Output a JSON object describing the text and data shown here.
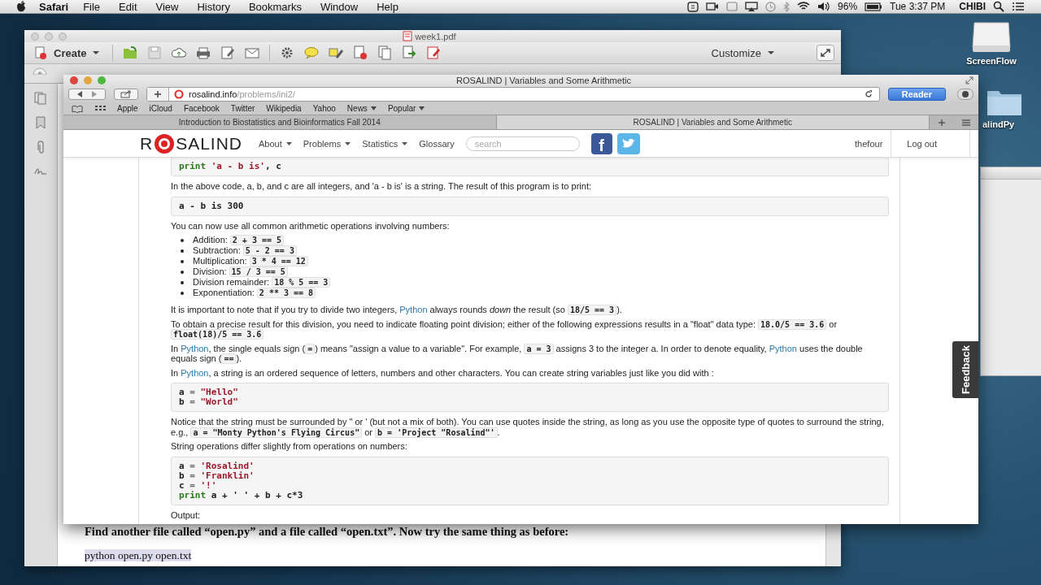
{
  "menubar": {
    "app": "Safari",
    "menus": [
      "File",
      "Edit",
      "View",
      "History",
      "Bookmarks",
      "Window",
      "Help"
    ],
    "battery": "96%",
    "clock": "Tue 3:37 PM",
    "user": "CHIBI"
  },
  "desktop_icons": [
    {
      "kind": "drive",
      "label": "ScreenFlow"
    },
    {
      "kind": "folder",
      "label": "alindPy"
    }
  ],
  "pdf_window": {
    "title": "week1.pdf",
    "create": "Create",
    "customize": "Customize",
    "body": [
      {
        "kind": "heading",
        "text": "Find another file called “open.py” and a file called “open.txt”. Now try the same thing as before:"
      },
      {
        "kind": "command",
        "text": "python open.py open.txt"
      }
    ]
  },
  "browser": {
    "title": "ROSALIND | Variables and Some Arithmetic",
    "url_host": "rosalind.info",
    "url_path": "/problems/ini2/",
    "reader": "Reader",
    "bookmarks": [
      {
        "label": "Apple",
        "dropdown": false
      },
      {
        "label": "iCloud",
        "dropdown": false
      },
      {
        "label": "Facebook",
        "dropdown": false
      },
      {
        "label": "Twitter",
        "dropdown": false
      },
      {
        "label": "Wikipedia",
        "dropdown": false
      },
      {
        "label": "Yahoo",
        "dropdown": false
      },
      {
        "label": "News",
        "dropdown": true
      },
      {
        "label": "Popular",
        "dropdown": true
      }
    ],
    "tabs": [
      {
        "label": "Introduction to Biostatistics and Bioinformatics Fall 2014",
        "selected": false
      },
      {
        "label": "ROSALIND | Variables and Some Arithmetic",
        "selected": true
      }
    ],
    "site": {
      "logo_left": "R",
      "logo_right": "SALIND",
      "nav": [
        {
          "label": "About",
          "dropdown": true
        },
        {
          "label": "Problems",
          "dropdown": true
        },
        {
          "label": "Statistics",
          "dropdown": true
        },
        {
          "label": "Glossary",
          "dropdown": false
        }
      ],
      "search_placeholder": "search",
      "social": [
        {
          "kind": "facebook",
          "glyph": "f"
        },
        {
          "kind": "twitter"
        }
      ],
      "user": "thefour",
      "logout": "Log out",
      "feedback": "Feedback",
      "content": [
        {
          "kind": "code",
          "lines": [
            [
              {
                "t": "print",
                "kind": "kw"
              },
              {
                "t": " 'a - b is'",
                "kind": "str"
              },
              {
                "t": ", c",
                "kind": "plain"
              }
            ]
          ]
        },
        {
          "kind": "para",
          "parts": [
            {
              "t": "In the above code, a, b, and c are all integers, and 'a - b is' is a string. The result of this program is to print:",
              "kind": "text"
            }
          ]
        },
        {
          "kind": "code",
          "lines": [
            [
              {
                "t": "a - b is 300",
                "kind": "plain"
              }
            ]
          ]
        },
        {
          "kind": "para",
          "parts": [
            {
              "t": "You can now use all common arithmetic operations involving numbers:",
              "kind": "text"
            }
          ]
        },
        {
          "kind": "list",
          "items": [
            {
              "label": "Addition:",
              "code": "2 + 3 == 5"
            },
            {
              "label": "Subtraction:",
              "code": "5 - 2 == 3"
            },
            {
              "label": "Multiplication:",
              "code": "3 * 4 == 12"
            },
            {
              "label": "Division:",
              "code": "15 / 3 == 5"
            },
            {
              "label": "Division remainder:",
              "code": "18 % 5 == 3"
            },
            {
              "label": "Exponentiation:",
              "code": "2 ** 3 == 8"
            }
          ]
        },
        {
          "kind": "para",
          "parts": [
            {
              "t": "It is important to note that if you try to divide two integers, ",
              "kind": "text"
            },
            {
              "t": "Python",
              "kind": "link"
            },
            {
              "t": " always rounds ",
              "kind": "text"
            },
            {
              "t": "down",
              "kind": "em"
            },
            {
              "t": " the result (so ",
              "kind": "text"
            },
            {
              "t": "18/5 == 3",
              "kind": "code"
            },
            {
              "t": ").",
              "kind": "text"
            }
          ]
        },
        {
          "kind": "para",
          "parts": [
            {
              "t": "To obtain a precise result for this division, you need to indicate floating point division; either of the following expressions results in a \"float\" data type: ",
              "kind": "text"
            },
            {
              "t": "18.0/5 == 3.6",
              "kind": "code"
            },
            {
              "t": " or ",
              "kind": "text"
            },
            {
              "t": "float(18)/5 == 3.6",
              "kind": "code"
            }
          ]
        },
        {
          "kind": "para",
          "parts": [
            {
              "t": "In ",
              "kind": "text"
            },
            {
              "t": "Python",
              "kind": "link"
            },
            {
              "t": ", the single equals sign (",
              "kind": "text"
            },
            {
              "t": "=",
              "kind": "code"
            },
            {
              "t": ") means \"assign a value to a variable\". For example, ",
              "kind": "text"
            },
            {
              "t": "a = 3",
              "kind": "code"
            },
            {
              "t": " assigns 3 to the integer a. In order to denote equality, ",
              "kind": "text"
            },
            {
              "t": "Python",
              "kind": "link"
            },
            {
              "t": " uses the double equals sign (",
              "kind": "text"
            },
            {
              "t": "==",
              "kind": "code"
            },
            {
              "t": ").",
              "kind": "text"
            }
          ]
        },
        {
          "kind": "para",
          "parts": [
            {
              "t": "In ",
              "kind": "text"
            },
            {
              "t": "Python",
              "kind": "link"
            },
            {
              "t": ", a string is an ordered sequence of letters, numbers and other characters. You can create string variables just like you did with :",
              "kind": "text"
            }
          ]
        },
        {
          "kind": "code",
          "lines": [
            [
              {
                "t": "a ",
                "kind": "plain"
              },
              {
                "t": "=",
                "kind": "op"
              },
              {
                "t": " \"Hello\"",
                "kind": "str"
              }
            ],
            [
              {
                "t": "b ",
                "kind": "plain"
              },
              {
                "t": "=",
                "kind": "op"
              },
              {
                "t": " \"World\"",
                "kind": "str"
              }
            ]
          ]
        },
        {
          "kind": "para",
          "parts": [
            {
              "t": "Notice that the string must be surrounded by \" or ' (but not a mix of both). You can use quotes inside the string, as long as you use the opposite type of quotes to surround the string, e.g., ",
              "kind": "text"
            },
            {
              "t": "a = \"Monty Python's Flying Circus\"",
              "kind": "code"
            },
            {
              "t": " or ",
              "kind": "text"
            },
            {
              "t": "b = 'Project \"Rosalind\"'",
              "kind": "code"
            },
            {
              "t": ".",
              "kind": "text"
            }
          ]
        },
        {
          "kind": "para",
          "parts": [
            {
              "t": "String operations differ slightly from operations on numbers:",
              "kind": "text"
            }
          ]
        },
        {
          "kind": "code",
          "lines": [
            [
              {
                "t": "a ",
                "kind": "plain"
              },
              {
                "t": "=",
                "kind": "op"
              },
              {
                "t": " 'Rosalind'",
                "kind": "str"
              }
            ],
            [
              {
                "t": "b ",
                "kind": "plain"
              },
              {
                "t": "=",
                "kind": "op"
              },
              {
                "t": " 'Franklin'",
                "kind": "str"
              }
            ],
            [
              {
                "t": "c ",
                "kind": "plain"
              },
              {
                "t": "=",
                "kind": "op"
              },
              {
                "t": " '!'",
                "kind": "str"
              }
            ],
            [
              {
                "t": "print",
                "kind": "kw"
              },
              {
                "t": " a + ' ' + b + c*3",
                "kind": "plain"
              }
            ]
          ]
        },
        {
          "kind": "para",
          "parts": [
            {
              "t": "Output:",
              "kind": "text"
            }
          ]
        }
      ]
    }
  }
}
